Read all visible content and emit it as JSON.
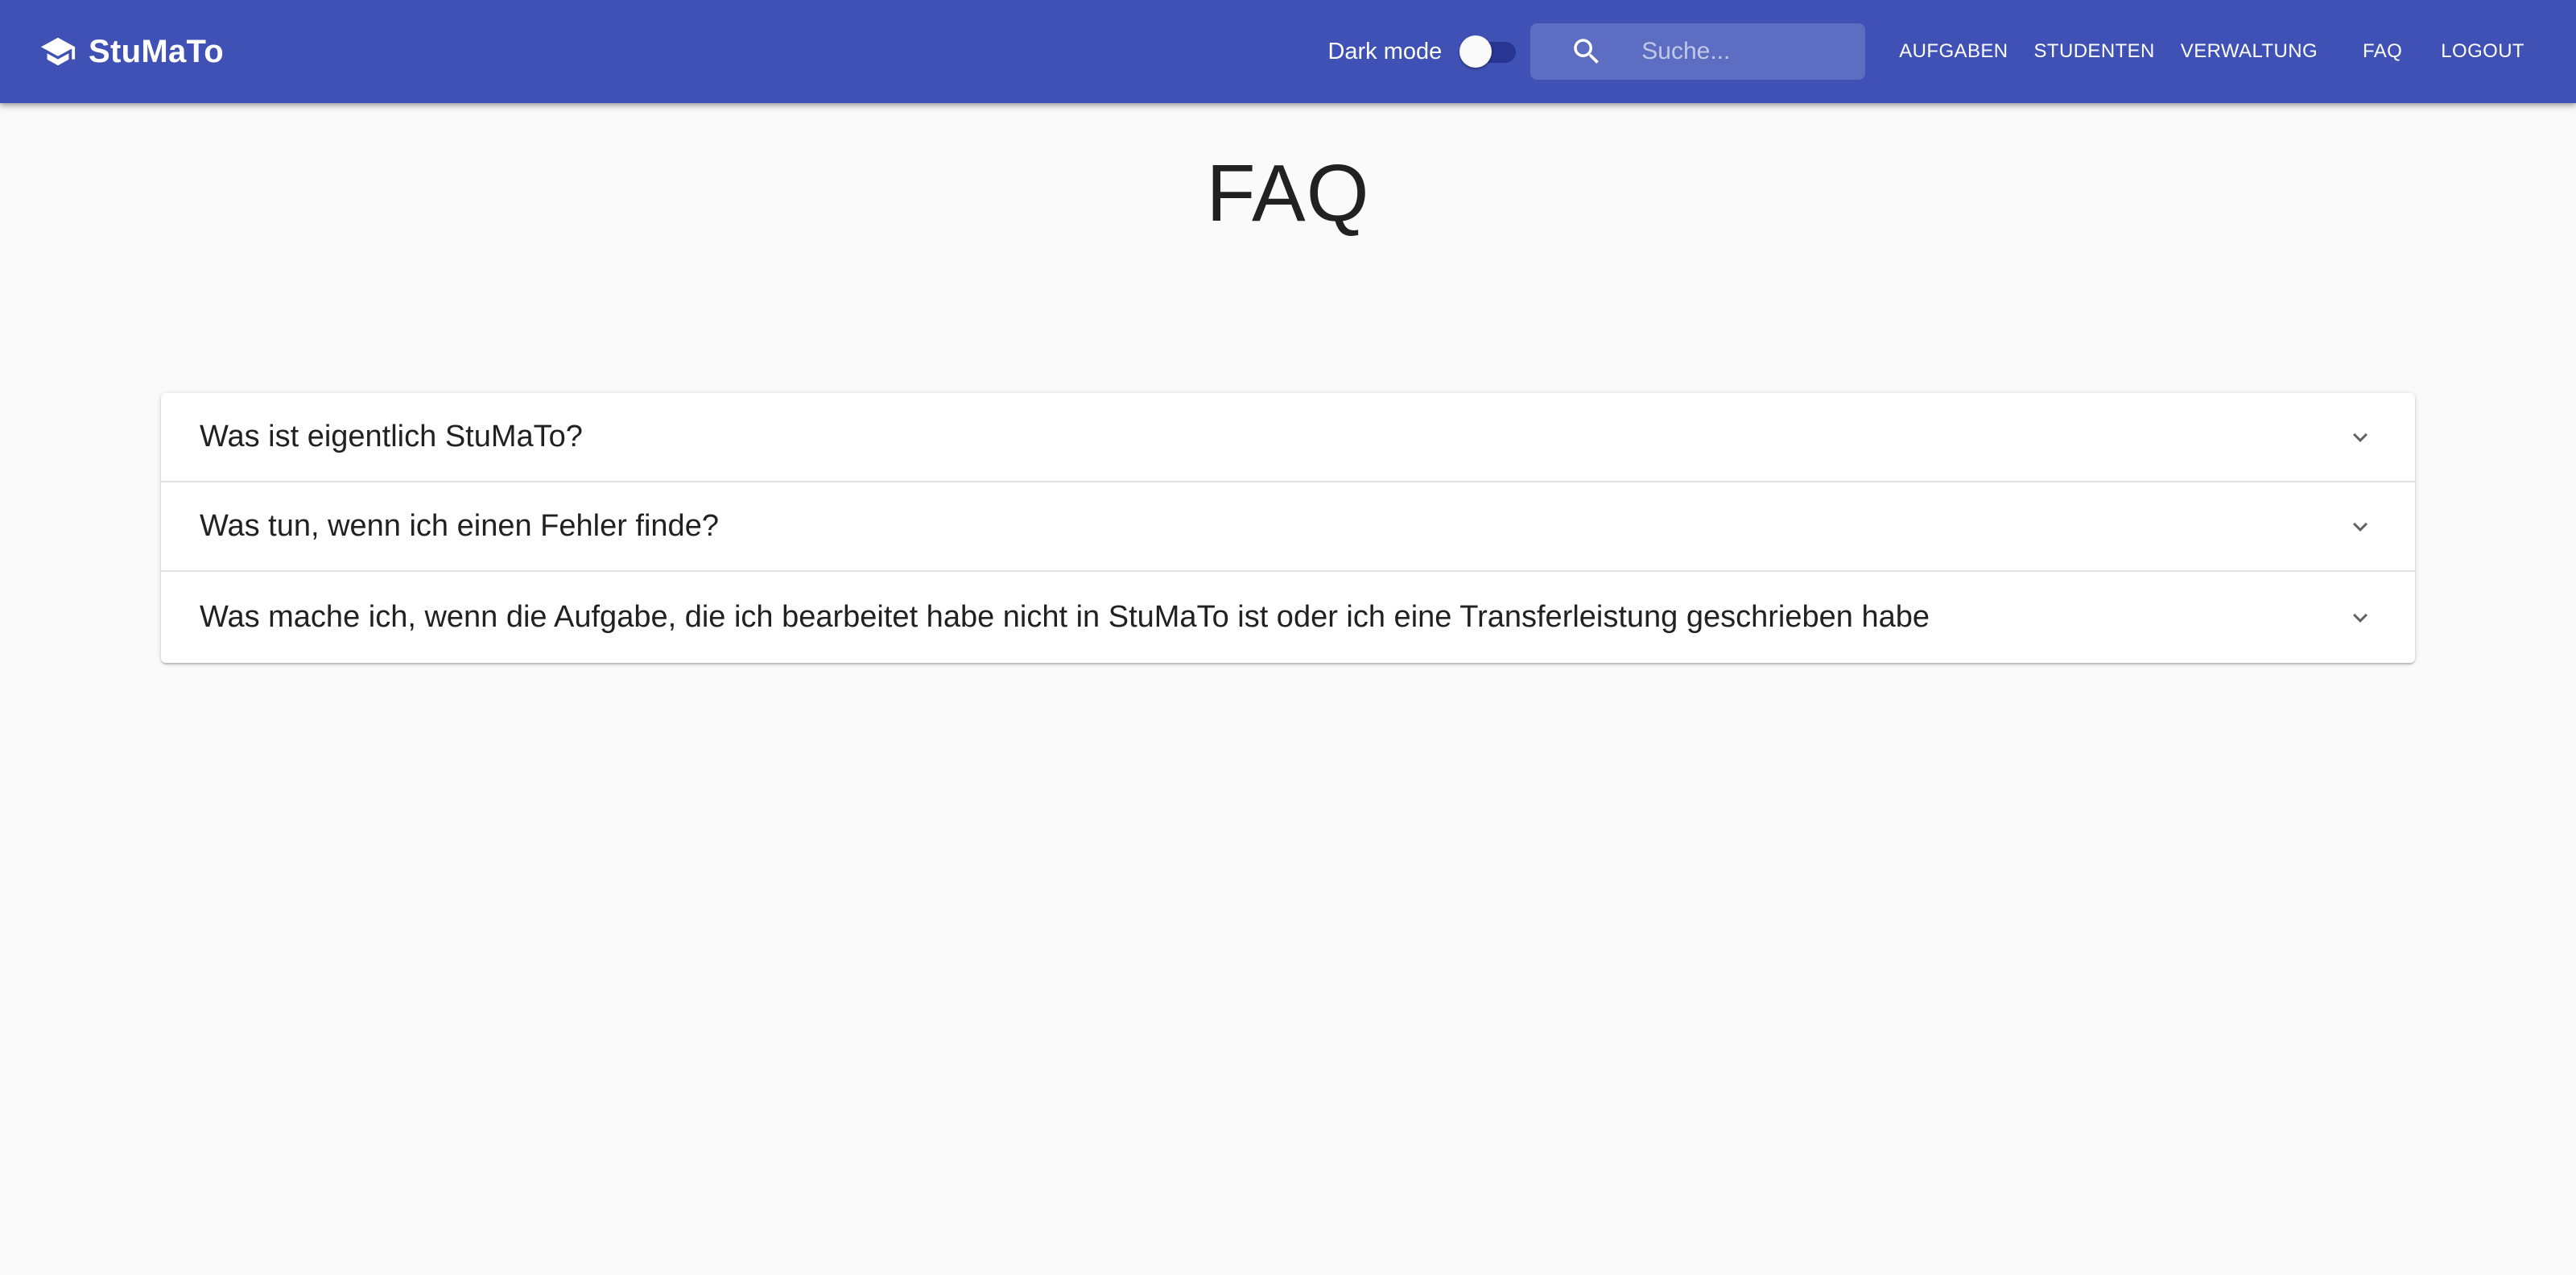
{
  "app": {
    "name": "StuMaTo",
    "logo_icon": "school-cap-icon"
  },
  "header": {
    "dark_mode_label": "Dark mode",
    "dark_mode_enabled": false,
    "search": {
      "placeholder": "Suche...",
      "value": "",
      "icon": "search-icon"
    },
    "nav": [
      {
        "label": "Aufgaben"
      },
      {
        "label": "Studenten"
      },
      {
        "label": "Verwaltung"
      },
      {
        "label": "FAQ"
      },
      {
        "label": "Logout"
      }
    ]
  },
  "main": {
    "title": "FAQ",
    "faq_items": [
      {
        "question": "Was ist eigentlich StuMaTo?",
        "expanded": false
      },
      {
        "question": "Was tun, wenn ich einen Fehler finde?",
        "expanded": false
      },
      {
        "question": "Was mache ich, wenn die Aufgabe, die ich bearbeitet habe nicht in StuMaTo ist oder ich eine Transferleistung geschrieben habe",
        "expanded": false
      }
    ]
  },
  "colors": {
    "primary": "#3f51b5",
    "toggle_track": "#283593",
    "background": "#fafafa",
    "text": "#212121"
  }
}
